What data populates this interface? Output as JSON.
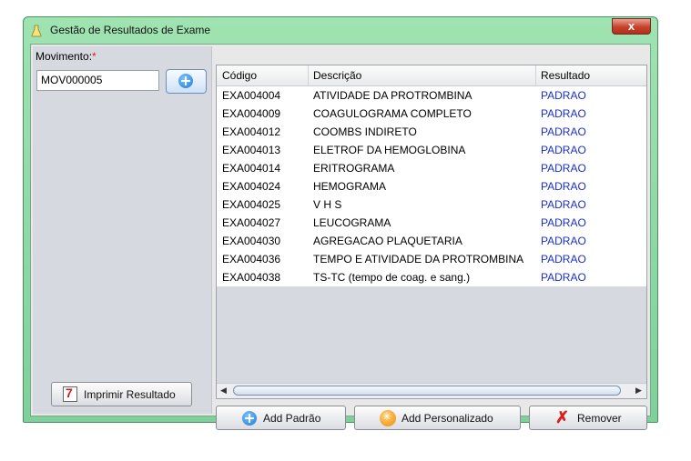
{
  "window": {
    "title": "Gestão de Resultados de Exame",
    "close_glyph": "x"
  },
  "movimento": {
    "label": "Movimento:",
    "required_mark": "*",
    "value": "MOV000005"
  },
  "buttons": {
    "print": "Imprimir Resultado",
    "add_standard": "Add Padrão",
    "add_custom": "Add Personalizado",
    "remove": "Remover"
  },
  "table": {
    "columns": [
      "Código",
      "Descrição",
      "Resultado"
    ],
    "rows": [
      [
        "EXA004004",
        "ATIVIDADE DA PROTROMBINA",
        "PADRAO"
      ],
      [
        "EXA004009",
        "COAGULOGRAMA COMPLETO",
        "PADRAO"
      ],
      [
        "EXA004012",
        "COOMBS INDIRETO",
        "PADRAO"
      ],
      [
        "EXA004013",
        "ELETROF DA HEMOGLOBINA",
        "PADRAO"
      ],
      [
        "EXA004014",
        "ERITROGRAMA",
        "PADRAO"
      ],
      [
        "EXA004024",
        "HEMOGRAMA",
        "PADRAO"
      ],
      [
        "EXA004025",
        "V H S",
        "PADRAO"
      ],
      [
        "EXA004027",
        "LEUCOGRAMA",
        "PADRAO"
      ],
      [
        "EXA004030",
        "AGREGACAO PLAQUETARIA",
        "PADRAO"
      ],
      [
        "EXA004036",
        "TEMPO E ATIVIDADE DA PROTROMBINA",
        "PADRAO"
      ],
      [
        "EXA004038",
        "TS-TC (tempo de coag. e sang.)",
        "PADRAO"
      ]
    ]
  },
  "colors": {
    "result_text": "#1a2fd0",
    "title_bar": "#8fdca6",
    "required_mark": "#e02020"
  },
  "icons": {
    "title": "flask-icon",
    "add_movimento": "plus-circle-icon",
    "print": "print-icon",
    "add_standard": "plus-circle-icon",
    "add_custom": "asterisk-icon",
    "remove": "red-x-icon"
  }
}
